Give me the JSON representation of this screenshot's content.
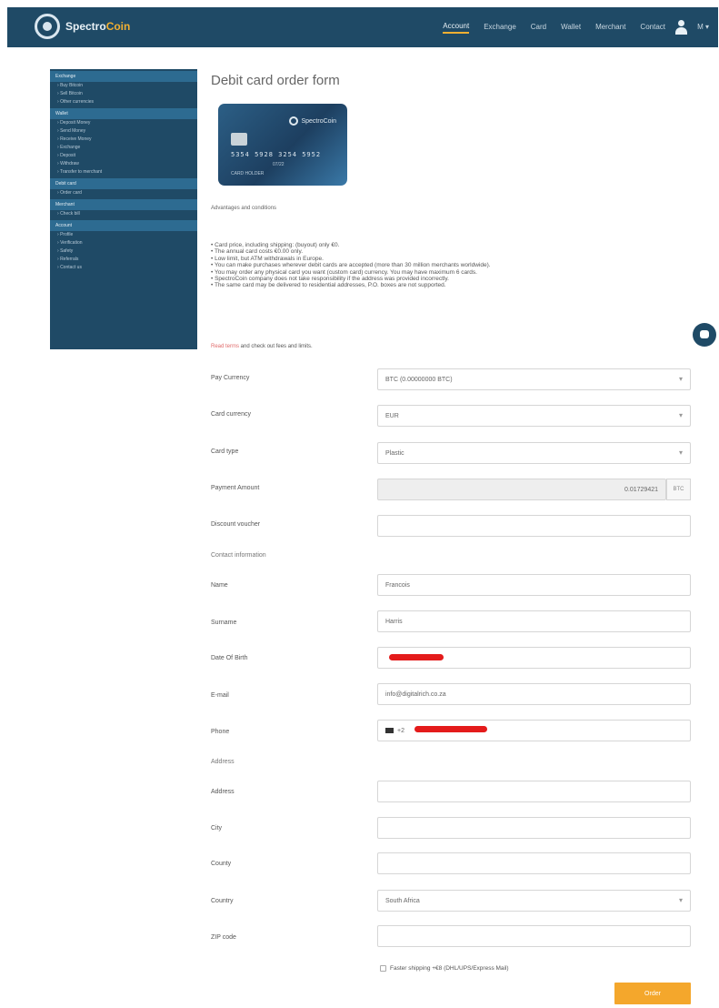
{
  "header": {
    "logo_text": "Spectro",
    "logo_text_accent": "Coin",
    "nav": [
      "Account",
      "Exchange",
      "Card",
      "Wallet",
      "Merchant",
      "Contact"
    ],
    "user_menu": "M ▾"
  },
  "sidebar": {
    "sections": [
      {
        "title": "Exchange",
        "items": [
          "Buy Bitcoin",
          "Sell Bitcoin",
          "Other currencies"
        ]
      },
      {
        "title": "Wallet",
        "items": [
          "Deposit Money",
          "Send Money",
          "Receive Money",
          "Exchange",
          "Deposit",
          "Withdraw",
          "Transfer to merchant"
        ]
      },
      {
        "title": "Debit card",
        "items": [
          "Order card"
        ]
      },
      {
        "title": "Merchant",
        "items": [
          "Check bill"
        ]
      },
      {
        "title": "Account",
        "items": [
          "Profile",
          "Verification",
          "Safety",
          "Referrals",
          "Contact us"
        ]
      }
    ]
  },
  "page": {
    "title": "Debit card order form",
    "terms_label": "Advantages and conditions",
    "bullets": [
      "• Card price, including shipping: (buyout) only €0.",
      "• The annual card costs €0.00 only.",
      "• Low limit, but ATM withdrawals in Europe.",
      "• You can make purchases wherever debit cards are accepted (more than 30 million merchants worldwide).",
      "• You may order any physical card you want (custom card) currency. You may have maximum 6 cards.",
      "• SpectroCoin company does not take responsibility if the address was provided incorrectly.",
      "• The same card may be delivered to residential addresses, P.O. boxes are not supported."
    ],
    "terms_link": "Read terms",
    "terms_rest": " and check out fees and limits."
  },
  "card": {
    "brand": "SpectroCoin",
    "number": "5354 5928 3254 5952",
    "valid": "07/22",
    "holder": "CARD HOLDER"
  },
  "form": {
    "pay_currency": {
      "label": "Pay Currency",
      "value": "BTC (0.00000000 BTC)"
    },
    "card_currency": {
      "label": "Card currency",
      "value": "EUR"
    },
    "card_type": {
      "label": "Card type",
      "value": "Plastic"
    },
    "payment_amount": {
      "label": "Payment Amount",
      "value": "0.01729421",
      "unit": "BTC"
    },
    "discount_voucher": {
      "label": "Discount voucher",
      "value": ""
    },
    "contact_section": "Contact information",
    "name": {
      "label": "Name",
      "value": "Francois"
    },
    "surname": {
      "label": "Surname",
      "value": "Harris"
    },
    "dob": {
      "label": "Date Of Birth",
      "value": ""
    },
    "email": {
      "label": "E-mail",
      "value": "info@digitalrich.co.za"
    },
    "phone": {
      "label": "Phone",
      "code": "+2"
    },
    "address_section": "Address",
    "address": {
      "label": "Address",
      "value": ""
    },
    "city": {
      "label": "City",
      "value": ""
    },
    "county": {
      "label": "County",
      "value": ""
    },
    "country": {
      "label": "Country",
      "value": "South Africa"
    },
    "zip": {
      "label": "ZIP code",
      "value": ""
    },
    "shipping_label": "Faster shipping +€8 (DHL/UPS/Express Mail)",
    "order_button": "Order"
  }
}
